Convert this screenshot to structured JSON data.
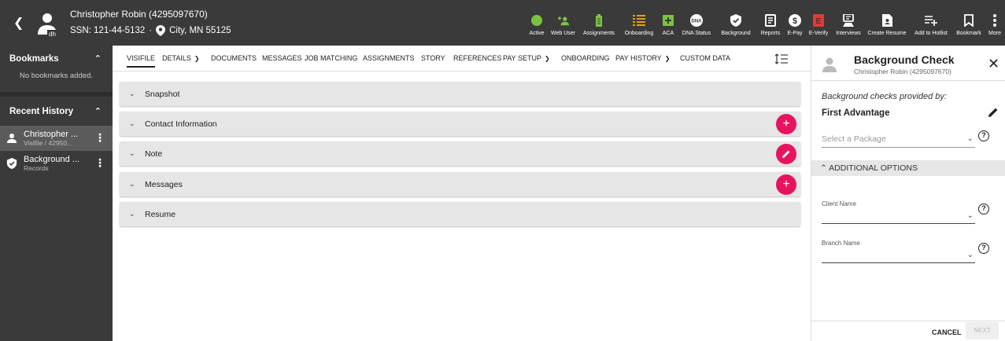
{
  "header": {
    "candidate_name": "Christopher Robin (4295097670)",
    "ssn": "SSN: 121-44-5132",
    "separator": "·",
    "location": "City, MN 55125",
    "avatar_badge": "dh"
  },
  "toolbar": [
    {
      "label": "Active",
      "icon": "status-dot-icon",
      "color": "#7cc242"
    },
    {
      "label": "Web User",
      "icon": "add-user-icon",
      "color": "#7cc242"
    },
    {
      "label": "Assignments",
      "icon": "battery-icon",
      "color": "#7cc242"
    },
    {
      "label": "Onboarding",
      "icon": "list-icon",
      "color": "#f2b21b"
    },
    {
      "label": "ACA",
      "icon": "plus-box-icon",
      "color": "#7cc242"
    },
    {
      "label": "DNA Status",
      "icon": "dna-icon",
      "color": "#ffffff"
    },
    {
      "label": "Background",
      "icon": "shield-check-icon",
      "color": "#ffffff"
    },
    {
      "label": "Reports",
      "icon": "report-icon",
      "color": "#ffffff"
    },
    {
      "label": "E-Pay",
      "icon": "dollar-icon",
      "color": "#ffffff"
    },
    {
      "label": "E-Verify",
      "icon": "e-verify-icon",
      "color": "#e53935"
    },
    {
      "label": "Interviews",
      "icon": "interview-icon",
      "color": "#ffffff"
    },
    {
      "label": "Create Resume",
      "icon": "resume-icon",
      "color": "#ffffff"
    },
    {
      "label": "Add to Hotlist",
      "icon": "playlist-add-icon",
      "color": "#ffffff"
    },
    {
      "label": "Bookmark",
      "icon": "bookmark-icon",
      "color": "#ffffff"
    },
    {
      "label": "More",
      "icon": "more-vert-icon",
      "color": "#ffffff"
    }
  ],
  "sidebar": {
    "bookmarks_title": "Bookmarks",
    "bookmarks_empty": "No bookmarks added.",
    "recent_title": "Recent History",
    "history": [
      {
        "title": "Christopher ...",
        "subtitle": "Visifile / 42950..."
      },
      {
        "title": "Background ...",
        "subtitle": "Records"
      }
    ]
  },
  "tabs": [
    {
      "label": "VISIFILE",
      "dropdown": false
    },
    {
      "label": "DETAILS",
      "dropdown": true
    },
    {
      "label": "DOCUMENTS",
      "dropdown": false
    },
    {
      "label": "MESSAGES",
      "dropdown": false
    },
    {
      "label": "JOB MATCHING",
      "dropdown": false
    },
    {
      "label": "ASSIGNMENTS",
      "dropdown": false
    },
    {
      "label": "STORY",
      "dropdown": false
    },
    {
      "label": "REFERENCES",
      "dropdown": false
    },
    {
      "label": "PAY SETUP",
      "dropdown": true
    },
    {
      "label": "ONBOARDING",
      "dropdown": false
    },
    {
      "label": "PAY HISTORY",
      "dropdown": true
    },
    {
      "label": "CUSTOM DATA",
      "dropdown": false
    }
  ],
  "sections": [
    {
      "label": "Snapshot",
      "action": null
    },
    {
      "label": "Contact Information",
      "action": "+"
    },
    {
      "label": "Note",
      "action": "edit"
    },
    {
      "label": "Messages",
      "action": "+"
    },
    {
      "label": "Resume",
      "action": null
    }
  ],
  "panel": {
    "title": "Background Check",
    "subtitle": "Christopher Robin (4295097670)",
    "provided_by": "Background checks provided by:",
    "provider": "First Advantage",
    "package_placeholder": "Select a Package",
    "additional_options": "ADDITIONAL OPTIONS",
    "client_name_label": "Client Name",
    "branch_name_label": "Branch Name",
    "cancel_label": "CANCEL",
    "next_label": "NEXT"
  },
  "colors": {
    "topbar": "#3a3a3a",
    "accent_pink": "#e8135f",
    "status_green": "#7cc242",
    "status_amber": "#f2b21b",
    "status_red": "#e53935"
  }
}
